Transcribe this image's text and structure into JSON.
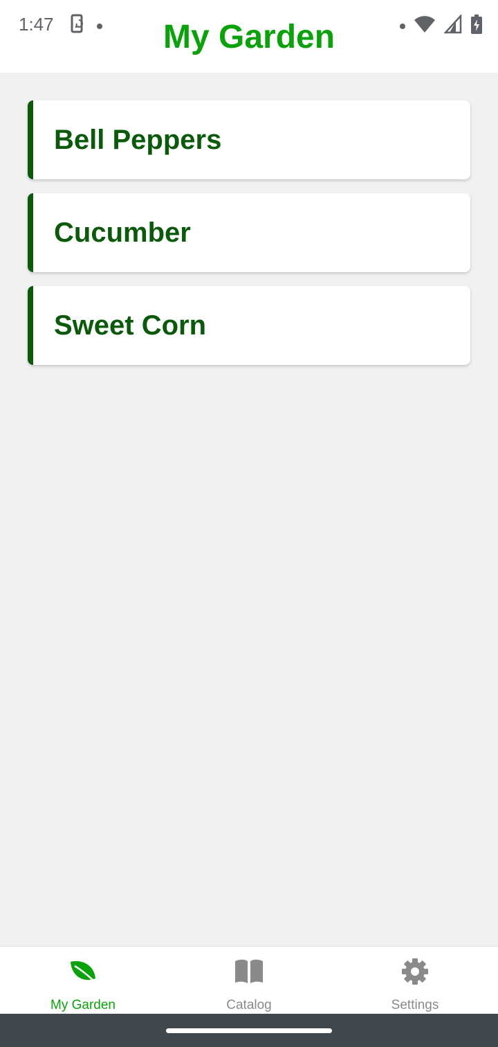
{
  "status_bar": {
    "time": "1:47",
    "left_icons": [
      "screen-rotate-icon",
      "notification-dot-icon"
    ],
    "right_icons": [
      "notification-dot-icon",
      "wifi-icon",
      "signal-icon",
      "battery-charging-icon"
    ]
  },
  "header": {
    "title": "My Garden"
  },
  "garden_items": [
    {
      "name": "Bell Peppers"
    },
    {
      "name": "Cucumber"
    },
    {
      "name": "Sweet Corn"
    }
  ],
  "bottom_nav": {
    "items": [
      {
        "label": "My Garden",
        "icon": "leaf-icon",
        "active": true
      },
      {
        "label": "Catalog",
        "icon": "book-icon",
        "active": false
      },
      {
        "label": "Settings",
        "icon": "gear-icon",
        "active": false
      }
    ]
  },
  "colors": {
    "accent": "#0aa10a",
    "card_text": "#0b5a0b",
    "background": "#f1f1f1",
    "inactive_nav": "#8a8a8a",
    "system_bar": "#41464d"
  }
}
